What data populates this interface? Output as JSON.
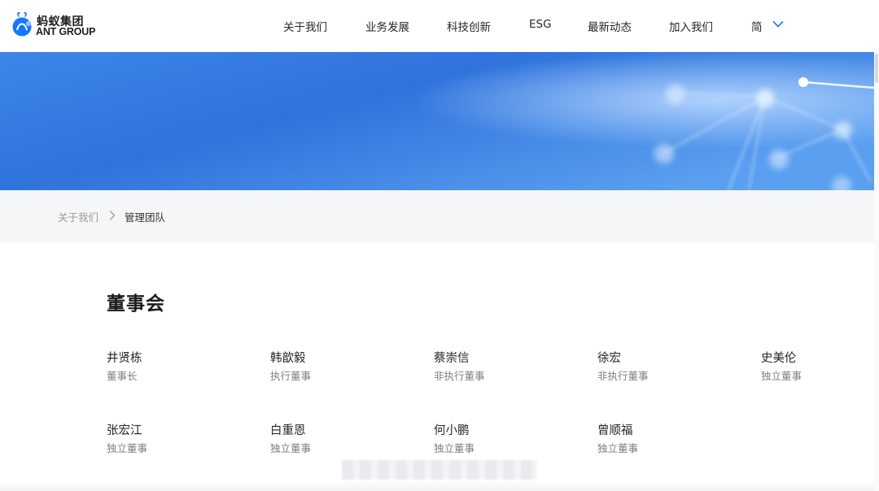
{
  "header": {
    "logo": {
      "cn": "蚂蚁集团",
      "en": "ANT GROUP",
      "brand_color": "#1677ff"
    },
    "nav": [
      "关于我们",
      "业务发展",
      "科技创新",
      "ESG",
      "最新动态",
      "加入我们"
    ],
    "language": {
      "label": "简",
      "icon": "chevron-down-icon"
    }
  },
  "banner": {
    "colors": [
      "#3b82e6",
      "#2f6fdc",
      "#6aa8f0"
    ]
  },
  "breadcrumb": {
    "parent": "关于我们",
    "separator_icon": "chevron-right-icon",
    "current": "管理团队"
  },
  "board": {
    "title": "董事会",
    "members": [
      {
        "name": "井贤栋",
        "role": "董事长"
      },
      {
        "name": "韩歆毅",
        "role": "执行董事"
      },
      {
        "name": "蔡崇信",
        "role": "非执行董事"
      },
      {
        "name": "徐宏",
        "role": "非执行董事"
      },
      {
        "name": "史美伦",
        "role": "独立董事"
      },
      {
        "name": "张宏江",
        "role": "独立董事"
      },
      {
        "name": "白重恩",
        "role": "独立董事"
      },
      {
        "name": "何小鹏",
        "role": "独立董事"
      },
      {
        "name": "曾顺福",
        "role": "独立董事"
      }
    ]
  }
}
